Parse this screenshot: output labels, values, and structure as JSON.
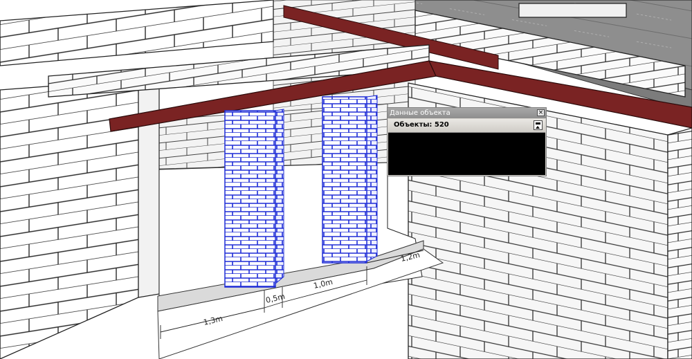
{
  "panel": {
    "title": "Данные объекта",
    "close_glyph": "×",
    "objects_label": "Объекты: 520"
  },
  "dimensions": {
    "d1": "1,3m",
    "d2": "0,5m",
    "d3": "1,0m",
    "d4": "1,2m"
  },
  "icons": [
    "close-icon",
    "collapse-icon"
  ],
  "colors": {
    "beam": "#7a2323",
    "pillar_brick": "#1d2bd6",
    "wall": "#ffffff",
    "panel_content": "#000000",
    "slab": "#8c8c8c"
  }
}
